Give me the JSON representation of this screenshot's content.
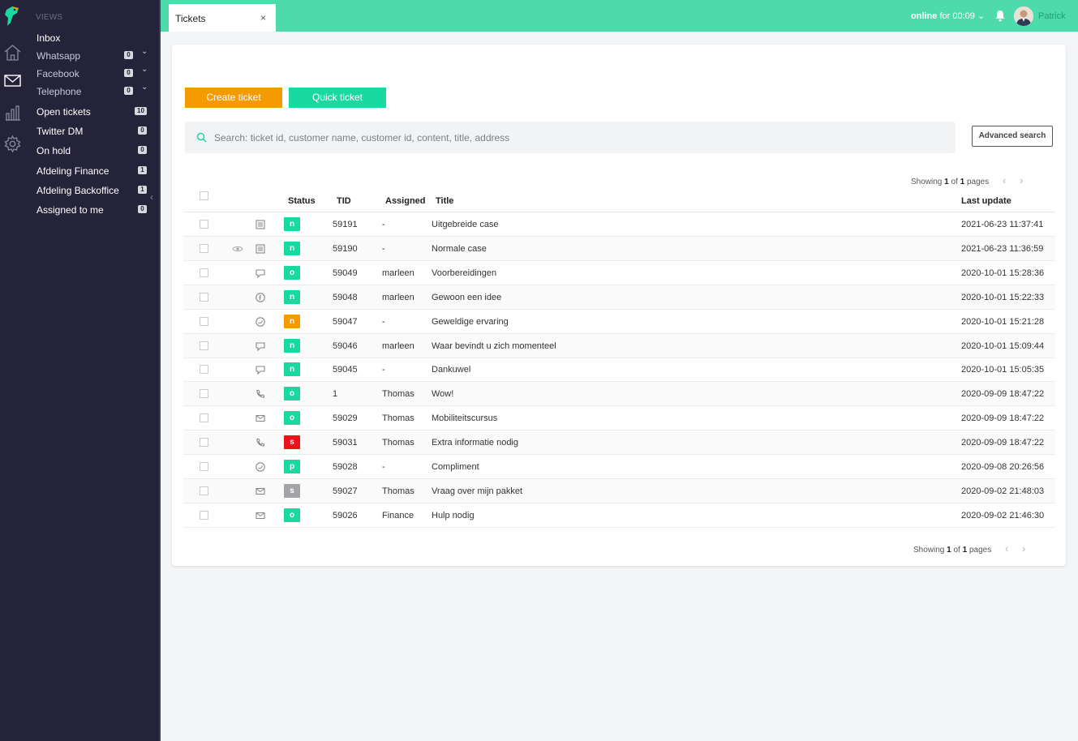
{
  "sidebar": {
    "views_title": "VIEWS",
    "items": [
      {
        "label": "Inbox",
        "badge": ""
      },
      {
        "label": "Whatsapp",
        "badge": "0"
      },
      {
        "label": "Facebook",
        "badge": "0"
      },
      {
        "label": "Telephone",
        "badge": "0"
      },
      {
        "label": "Open tickets",
        "badge": "10"
      },
      {
        "label": "Twitter DM",
        "badge": "0"
      },
      {
        "label": "On hold",
        "badge": "0"
      },
      {
        "label": "Afdeling Finance",
        "badge": "1"
      },
      {
        "label": "Afdeling Backoffice",
        "badge": "1"
      },
      {
        "label": "Assigned to me",
        "badge": "0"
      }
    ]
  },
  "topbar": {
    "tab_label": "Tickets",
    "tab_close": "×",
    "status_online": "online",
    "status_rest": " for 00:09",
    "user_name": "Patrick"
  },
  "toolbar": {
    "create_label": "Create ticket",
    "quick_label": "Quick ticket",
    "search_placeholder": "Search: ticket id, customer name, customer id, content, title, address",
    "advanced_label": "Advanced search"
  },
  "pagination": {
    "showing": "Showing",
    "current": "1",
    "of": "of",
    "total": "1",
    "pages": "pages"
  },
  "table": {
    "headers": {
      "status": "Status",
      "tid": "TID",
      "assigned": "Assigned",
      "title": "Title",
      "last_update": "Last update"
    },
    "status_colors": {
      "n": "#1ad9a0",
      "o": "#1ad9a0",
      "p": "#1ad9a0",
      "s_red": "#e8141a",
      "n_orange": "#f59a00",
      "s_grey": "#a4a4a8"
    },
    "rows": [
      {
        "channel": "note-icon",
        "viewed": false,
        "status": "n",
        "tid": "59191",
        "assigned": "-",
        "title": "Uitgebreide case",
        "updated": "2021-06-23 11:37:41"
      },
      {
        "channel": "note-icon",
        "viewed": true,
        "status": "n",
        "tid": "59190",
        "assigned": "-",
        "title": "Normale case",
        "updated": "2021-06-23 11:36:59"
      },
      {
        "channel": "chat-icon",
        "viewed": false,
        "status": "o",
        "tid": "59049",
        "assigned": "marleen",
        "title": "Voorbereidingen",
        "updated": "2020-10-01 15:28:36"
      },
      {
        "channel": "facebook-icon",
        "viewed": false,
        "status": "n",
        "tid": "59048",
        "assigned": "marleen",
        "title": "Gewoon een idee",
        "updated": "2020-10-01 15:22:33"
      },
      {
        "channel": "twitter-icon",
        "viewed": false,
        "status": "n",
        "tid": "59047",
        "assigned": "-",
        "title": "Geweldige ervaring",
        "updated": "2020-10-01 15:21:28"
      },
      {
        "channel": "chat-icon",
        "viewed": false,
        "status": "n",
        "tid": "59046",
        "assigned": "marleen",
        "title": "Waar bevindt u zich momenteel",
        "updated": "2020-10-01 15:09:44"
      },
      {
        "channel": "chat-icon",
        "viewed": false,
        "status": "n",
        "tid": "59045",
        "assigned": "-",
        "title": "Dankuwel",
        "updated": "2020-10-01 15:05:35"
      },
      {
        "channel": "phone-icon",
        "viewed": false,
        "status": "o",
        "tid": "1",
        "assigned": "Thomas",
        "title": "Wow!",
        "updated": "2020-09-09 18:47:22"
      },
      {
        "channel": "mail-icon",
        "viewed": false,
        "status": "o",
        "tid": "59029",
        "assigned": "Thomas",
        "title": "Mobiliteitscursus",
        "updated": "2020-09-09 18:47:22"
      },
      {
        "channel": "phone-icon",
        "viewed": false,
        "status": "s",
        "tid": "59031",
        "assigned": "Thomas",
        "title": "Extra informatie nodig",
        "updated": "2020-09-09 18:47:22"
      },
      {
        "channel": "twitter-icon",
        "viewed": false,
        "status": "p",
        "tid": "59028",
        "assigned": "-",
        "title": "Compliment",
        "updated": "2020-09-08 20:26:56"
      },
      {
        "channel": "mail-icon",
        "viewed": false,
        "status": "s",
        "tid": "59027",
        "assigned": "Thomas",
        "title": "Vraag over mijn pakket",
        "updated": "2020-09-02 21:48:03"
      },
      {
        "channel": "mail-icon",
        "viewed": false,
        "status": "o",
        "tid": "59026",
        "assigned": "Finance",
        "title": "Hulp nodig",
        "updated": "2020-09-02 21:46:30"
      }
    ],
    "status_color_keys": [
      "n",
      "n",
      "o",
      "n",
      "n_orange",
      "n",
      "n",
      "o",
      "o",
      "s_red",
      "p",
      "s_grey",
      "o"
    ]
  }
}
